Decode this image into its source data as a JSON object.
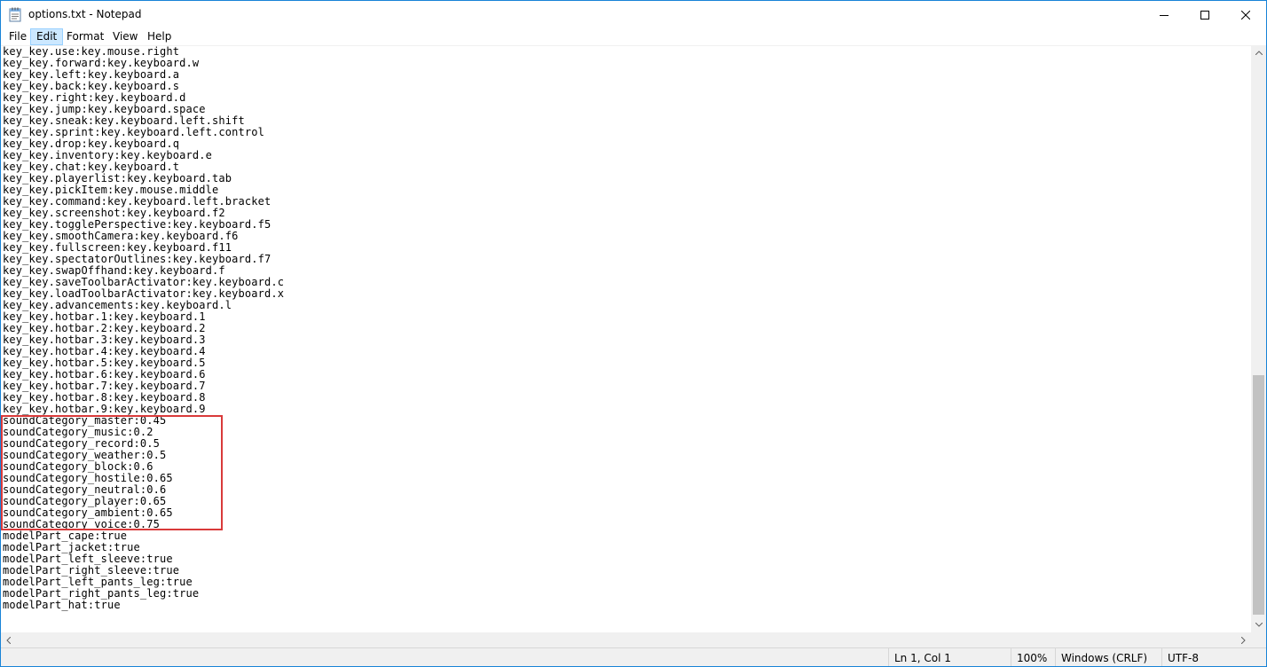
{
  "window": {
    "title": "options.txt - Notepad"
  },
  "menu": {
    "file": "File",
    "edit": "Edit",
    "format": "Format",
    "view": "View",
    "help": "Help"
  },
  "editor": {
    "lines": [
      "key_key.use:key.mouse.right",
      "key_key.forward:key.keyboard.w",
      "key_key.left:key.keyboard.a",
      "key_key.back:key.keyboard.s",
      "key_key.right:key.keyboard.d",
      "key_key.jump:key.keyboard.space",
      "key_key.sneak:key.keyboard.left.shift",
      "key_key.sprint:key.keyboard.left.control",
      "key_key.drop:key.keyboard.q",
      "key_key.inventory:key.keyboard.e",
      "key_key.chat:key.keyboard.t",
      "key_key.playerlist:key.keyboard.tab",
      "key_key.pickItem:key.mouse.middle",
      "key_key.command:key.keyboard.left.bracket",
      "key_key.screenshot:key.keyboard.f2",
      "key_key.togglePerspective:key.keyboard.f5",
      "key_key.smoothCamera:key.keyboard.f6",
      "key_key.fullscreen:key.keyboard.f11",
      "key_key.spectatorOutlines:key.keyboard.f7",
      "key_key.swapOffhand:key.keyboard.f",
      "key_key.saveToolbarActivator:key.keyboard.c",
      "key_key.loadToolbarActivator:key.keyboard.x",
      "key_key.advancements:key.keyboard.l",
      "key_key.hotbar.1:key.keyboard.1",
      "key_key.hotbar.2:key.keyboard.2",
      "key_key.hotbar.3:key.keyboard.3",
      "key_key.hotbar.4:key.keyboard.4",
      "key_key.hotbar.5:key.keyboard.5",
      "key_key.hotbar.6:key.keyboard.6",
      "key_key.hotbar.7:key.keyboard.7",
      "key_key.hotbar.8:key.keyboard.8",
      "key_key.hotbar.9:key.keyboard.9",
      "soundCategory_master:0.45",
      "soundCategory_music:0.2",
      "soundCategory_record:0.5",
      "soundCategory_weather:0.5",
      "soundCategory_block:0.6",
      "soundCategory_hostile:0.65",
      "soundCategory_neutral:0.6",
      "soundCategory_player:0.65",
      "soundCategory_ambient:0.65",
      "soundCategory_voice:0.75",
      "modelPart_cape:true",
      "modelPart_jacket:true",
      "modelPart_left_sleeve:true",
      "modelPart_right_sleeve:true",
      "modelPart_left_pants_leg:true",
      "modelPart_right_pants_leg:true",
      "modelPart_hat:true"
    ]
  },
  "status": {
    "position": "Ln 1, Col 1",
    "zoom": "100%",
    "line_ending": "Windows (CRLF)",
    "encoding": "UTF-8"
  },
  "colors": {
    "accent_border": "#1883d7",
    "highlight_box": "#d93a3a",
    "menu_active": "#cce8ff"
  }
}
